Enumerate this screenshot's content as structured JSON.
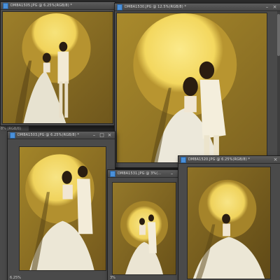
{
  "windows": [
    {
      "title": "DM8A1505.JPG @ 6.25%(RGB/8) *",
      "zoom": ""
    },
    {
      "title": "DM8A1530.JPG @ 12.5%(RGB/8) *",
      "zoom": ""
    },
    {
      "title": "DM8A1503.JPG @ 6.25%(RGB/8) *",
      "zoom": "6.25%"
    },
    {
      "title": "DM8A1531.JPG @ 3%(...",
      "zoom": "3%"
    },
    {
      "title": "DM8A1520.JPG @ 6.25%(RGB/8) *",
      "zoom": ""
    }
  ],
  "partial_title": "8% (RGB/8)",
  "controls": {
    "minimize": "–",
    "maximize": "□",
    "close": "×"
  },
  "colors": {
    "accent_yellow": "#e8c24a",
    "backdrop_gold": "#a98a2c",
    "ui_dark": "#2b2b2b"
  }
}
